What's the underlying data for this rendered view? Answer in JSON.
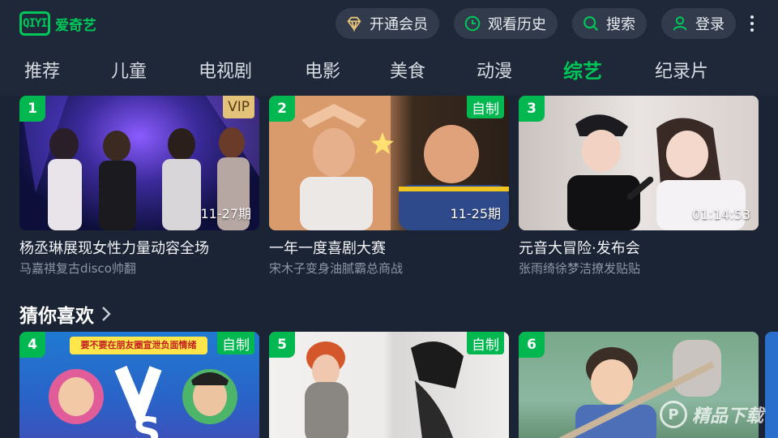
{
  "header": {
    "logo_mark": "QIYI",
    "logo_text": "爱奇艺",
    "actions": {
      "vip": "开通会员",
      "history": "观看历史",
      "search": "搜索",
      "login": "登录"
    }
  },
  "tabs": [
    "推荐",
    "儿童",
    "电视剧",
    "电影",
    "美食",
    "动漫",
    "综艺",
    "纪录片"
  ],
  "active_tab": "综艺",
  "top_cards": [
    {
      "rank": "1",
      "badge": "VIP",
      "duration": "11-27期",
      "title": "杨丞琳展现女性力量动容全场",
      "subtitle": "马嘉祺复古disco帅翻"
    },
    {
      "rank": "2",
      "badge": "自制",
      "duration": "11-25期",
      "title": "一年一度喜剧大赛",
      "subtitle": "宋木子变身油腻霸总商战"
    },
    {
      "rank": "3",
      "badge": "",
      "duration": "01:14:53",
      "title": "元音大冒险·发布会",
      "subtitle": "张雨绮徐梦洁撩发贴贴"
    }
  ],
  "section": {
    "title": "猜你喜欢"
  },
  "bottom_cards": [
    {
      "rank": "4",
      "badge": "自制",
      "banner": "要不要在朋友圈宣泄负面情绪"
    },
    {
      "rank": "5",
      "badge": "自制"
    },
    {
      "rank": "6",
      "badge": ""
    }
  ],
  "watermark": {
    "text": "精品下载"
  },
  "colors": {
    "accent": "#00c759",
    "background": "#1b2434",
    "pill": "#313b4b",
    "vip_badge": "#e3c27a"
  }
}
